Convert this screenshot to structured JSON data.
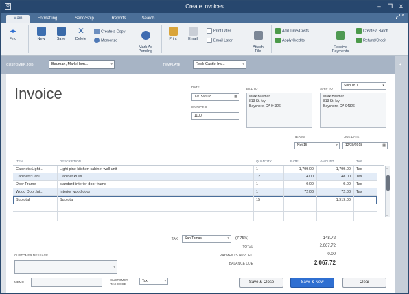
{
  "window": {
    "title": "Create Invoices",
    "sys_icon": "Q",
    "minimize": "–",
    "restore": "❐",
    "close": "✕"
  },
  "tabs": [
    {
      "label": "Main"
    },
    {
      "label": "Formatting"
    },
    {
      "label": "Send/Ship"
    },
    {
      "label": "Reports"
    },
    {
      "label": "Search"
    }
  ],
  "tabrow_icons": "⤢ ^",
  "ribbon": {
    "find": "Find",
    "new": "New",
    "save": "Save",
    "delete": "Delete",
    "create_copy": "Create a Copy",
    "memorize": "Memorize",
    "mark_pending": "Mark As\nPending",
    "print": "Print",
    "email": "Email",
    "print_later": "Print Later",
    "email_later": "Email Later",
    "attach_file": "Attach\nFile",
    "add_time_costs": "Add Time/Costs",
    "apply_credits": "Apply Credits",
    "receive_payments": "Receive\nPayments",
    "create_batch": "Create a Batch",
    "refund_credit": "Refund/Credit"
  },
  "customer_bar": {
    "customer_label": "CUSTOMER:JOB",
    "customer_value": "Bauman, Mark:Hom...",
    "template_label": "TEMPLATE",
    "template_value": "Rock Castle Inv..."
  },
  "invoice": {
    "title": "Invoice",
    "date_label": "DATE",
    "date_value": "12/15/2018",
    "invoice_no_label": "INVOICE #",
    "invoice_no_value": "1100",
    "bill_to_label": "BILL TO",
    "bill_to_lines": [
      "Mark Bauman",
      "813 St. Ivy",
      "Bayshore, CA  94326"
    ],
    "ship_to_label": "SHIP TO",
    "ship_to_select": "Ship To 1",
    "ship_to_lines": [
      "Mark Bauman",
      "813 St. Ivy",
      "Bayshore, CA 94326"
    ],
    "terms_label": "TERMS",
    "terms_value": "Net 15",
    "due_date_label": "DUE DATE",
    "due_date_value": "12/30/2018"
  },
  "grid": {
    "headers": {
      "item": "ITEM",
      "description": "DESCRIPTION",
      "quantity": "QUANTITY",
      "rate": "RATE",
      "amount": "AMOUNT",
      "tax": "TAX"
    },
    "rows": [
      {
        "item": "Cabinets:Light...",
        "description": "Light pine kitchen cabinet wall unit",
        "quantity": "1",
        "rate": "1,799.00",
        "amount": "1,799.00",
        "tax": "Tax"
      },
      {
        "item": "Cabinets:Cabi...",
        "description": "Cabinet Pulls",
        "quantity": "12",
        "rate": "4.00",
        "amount": "48.00",
        "tax": "Tax"
      },
      {
        "item": "Door Frame",
        "description": "standard interior door frame",
        "quantity": "1",
        "rate": "0.00",
        "amount": "0.00",
        "tax": "Tax"
      },
      {
        "item": "Wood Door:Int...",
        "description": "Interior wood door",
        "quantity": "1",
        "rate": "72.00",
        "amount": "72.00",
        "tax": "Tax"
      },
      {
        "item": "Subtotal",
        "description": "Subtotal",
        "quantity": "15",
        "rate": "",
        "amount": "1,919.00",
        "tax": ""
      }
    ]
  },
  "totals": {
    "tax_label": "TAX",
    "tax_select": "San Tomas",
    "tax_rate": "(7.75%)",
    "tax_value": "148.72",
    "total_label": "TOTAL",
    "total_value": "2,067.72",
    "payments_label": "PAYMENTS APPLIED",
    "payments_value": "0.00",
    "balance_label": "BALANCE DUE",
    "balance_value": "2,067.72"
  },
  "footer": {
    "customer_message_label": "CUSTOMER MESSAGE",
    "memo_label": "MEMO",
    "customer_tax_code_label": "CUSTOMER\nTAX CODE",
    "customer_tax_code_value": "Tax",
    "save_close": "Save & Close",
    "save_new": "Save & New",
    "clear": "Clear"
  }
}
